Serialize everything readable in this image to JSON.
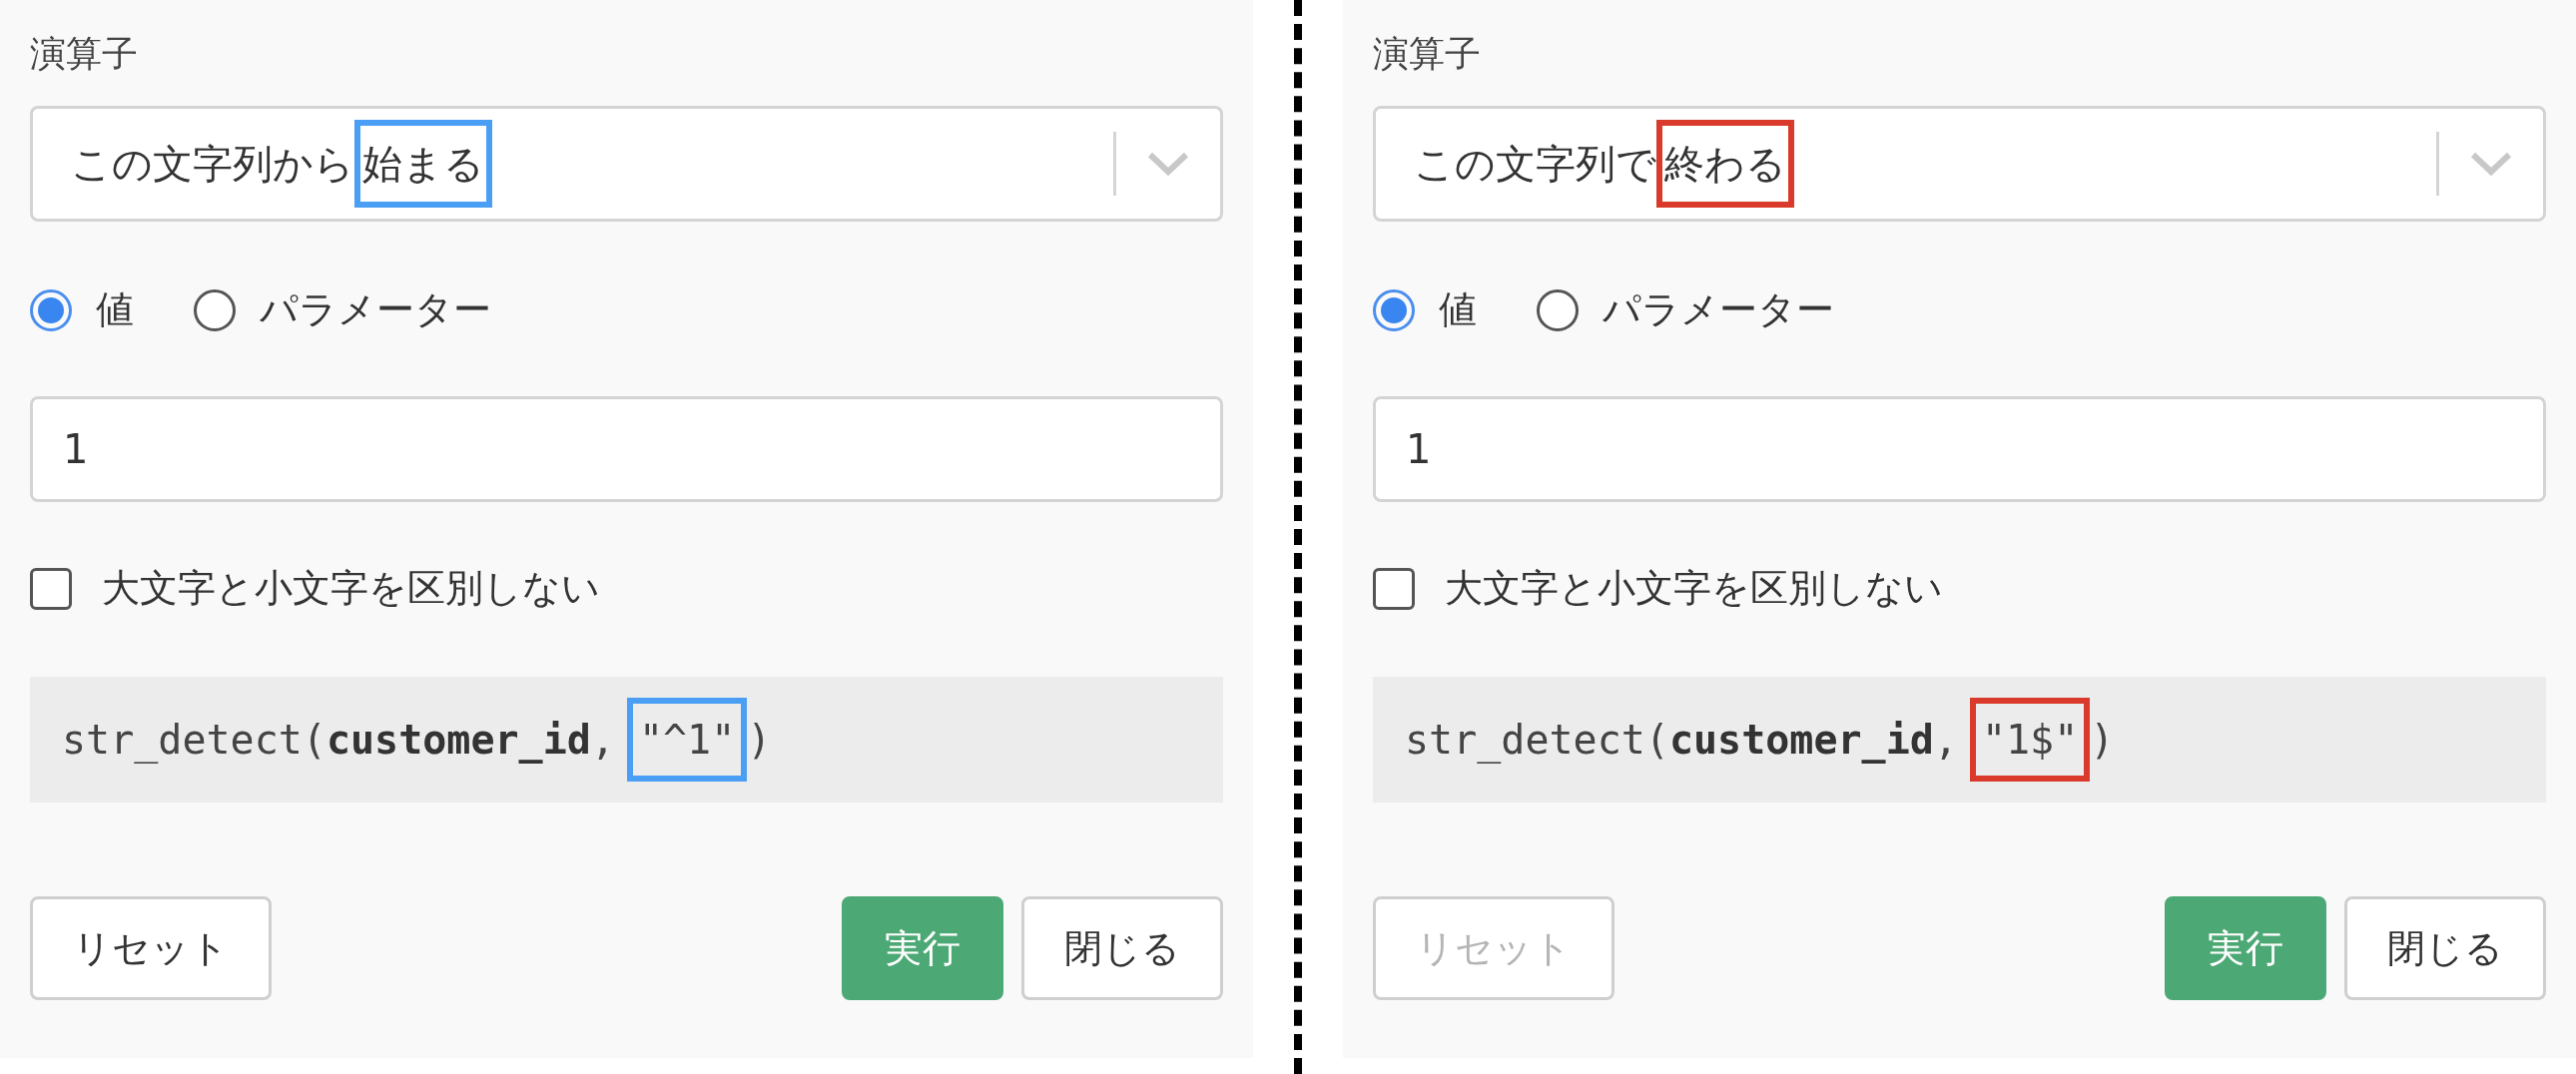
{
  "panels": [
    {
      "operator_label": "演算子",
      "operator": {
        "prefix": "この文字列から",
        "highlight": "始まる",
        "color": "#4a9ff5"
      },
      "radios": [
        {
          "label": "値",
          "selected": true
        },
        {
          "label": "パラメーター",
          "selected": false
        }
      ],
      "value": "1",
      "checkbox": {
        "label": "大文字と小文字を区別しない",
        "checked": false
      },
      "code": {
        "prefix": "str_detect(",
        "bold": "customer_id",
        "separator": ", ",
        "highlight": "\"^1\"",
        "suffix": ")"
      },
      "buttons": [
        {
          "label": "リセット",
          "kind": "secondary",
          "disabled": false
        },
        {
          "label": "実行",
          "kind": "primary",
          "disabled": false
        },
        {
          "label": "閉じる",
          "kind": "secondary",
          "disabled": false
        }
      ]
    },
    {
      "operator_label": "演算子",
      "operator": {
        "prefix": "この文字列で",
        "highlight": "終わる",
        "color": "#d93a2b"
      },
      "radios": [
        {
          "label": "値",
          "selected": true
        },
        {
          "label": "パラメーター",
          "selected": false
        }
      ],
      "value": "1",
      "checkbox": {
        "label": "大文字と小文字を区別しない",
        "checked": false
      },
      "code": {
        "prefix": "str_detect(",
        "bold": "customer_id",
        "separator": ", ",
        "highlight": "\"1$\"",
        "suffix": ")"
      },
      "buttons": [
        {
          "label": "リセット",
          "kind": "secondary",
          "disabled": true
        },
        {
          "label": "実行",
          "kind": "primary",
          "disabled": false
        },
        {
          "label": "閉じる",
          "kind": "secondary",
          "disabled": false
        }
      ]
    }
  ]
}
